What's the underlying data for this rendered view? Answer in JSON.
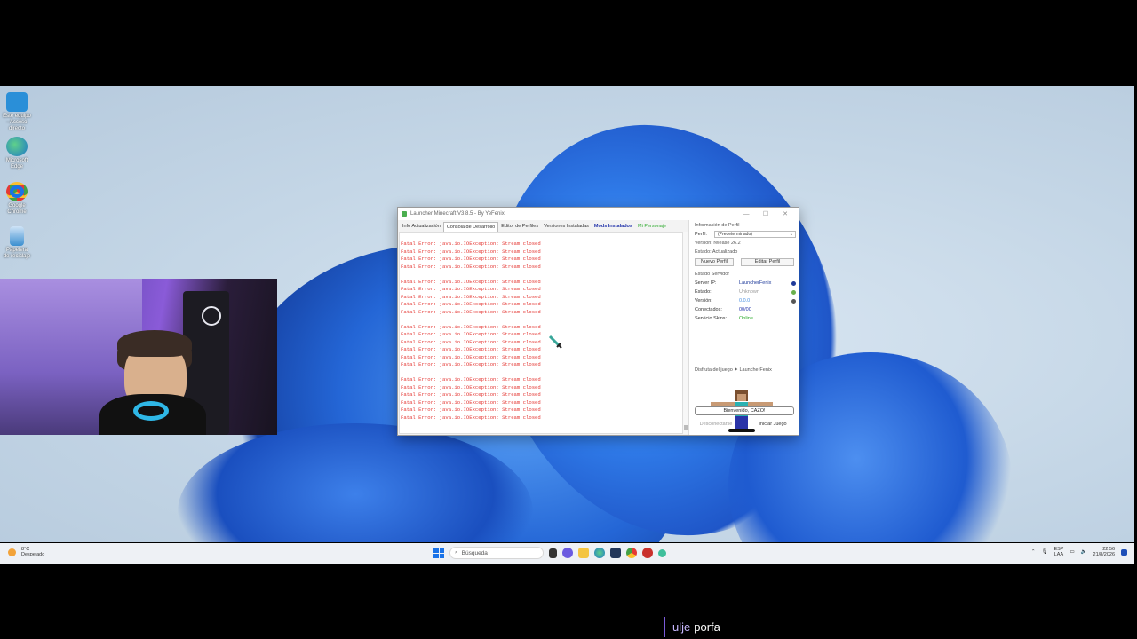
{
  "desktop": {
    "icons": [
      {
        "label": "Este equipo - Acceso directo",
        "icon": "monitor-icon",
        "color": "#2a8fd8"
      },
      {
        "label": "Microsoft Edge",
        "icon": "edge-icon",
        "color": "#1ea06e"
      },
      {
        "label": "Google Chrome",
        "icon": "chrome-icon",
        "color": "#e53935"
      },
      {
        "label": "Papelera de reciclaje",
        "icon": "recycle-bin-icon",
        "color": "#3b8fd0"
      }
    ]
  },
  "launcher": {
    "title": "Launcher Minecraft V3.8.5 - By YeFenix",
    "tabs": [
      {
        "label": "Info Actualización",
        "style": "normal"
      },
      {
        "label": "Consola de Desarrollo",
        "style": "active"
      },
      {
        "label": "Editor de Perfiles",
        "style": "normal"
      },
      {
        "label": "Versiones Instaladas",
        "style": "normal"
      },
      {
        "label": "Mods Instalados",
        "style": "mods"
      },
      {
        "label": "Mi Personaje",
        "style": "green"
      }
    ],
    "console": {
      "error_line": "Fatal Error: java.io.IOException: Stream closed",
      "groups": [
        4,
        5,
        6,
        6
      ]
    },
    "profile": {
      "section": "Información de Perfil",
      "perfil_label": "Perfil:",
      "perfil_value": "(Predeterminado)",
      "version_label": "Versión: release 26.2",
      "estado_label": "Estado: Actualizado",
      "new_button": "Nuevo Perfil",
      "edit_button": "Editar Perfil"
    },
    "server": {
      "section": "Estado Servidor",
      "rows": [
        {
          "label": "Server IP:",
          "value": "LauncherFenix",
          "color": "#1e3a9a"
        },
        {
          "label": "Estado:",
          "value": "Unknown",
          "color": "#999999"
        },
        {
          "label": "Versión:",
          "value": "0.0.0",
          "color": "#4a90e2"
        },
        {
          "label": "Conectados:",
          "value": "00/00",
          "color": "#2233aa"
        },
        {
          "label": "Servicio Skins:",
          "value": "Online",
          "color": "#2aa92a"
        }
      ]
    },
    "skin_section": "Disfruta del juego ✦ LauncherFenix",
    "welcome": "Bienvenido, CAZO!",
    "disconnect_button": "Desconectarse",
    "start_button": "Iniciar Juego"
  },
  "taskbar": {
    "weather_temp": "8°C",
    "weather_desc": "Despejado",
    "search_placeholder": "Búsqueda",
    "lang_top": "ESP",
    "lang_bottom": "LAA",
    "time": "22:56",
    "date": "21/8/2026"
  },
  "caption": {
    "user": "ulje",
    "message": "porfa"
  }
}
